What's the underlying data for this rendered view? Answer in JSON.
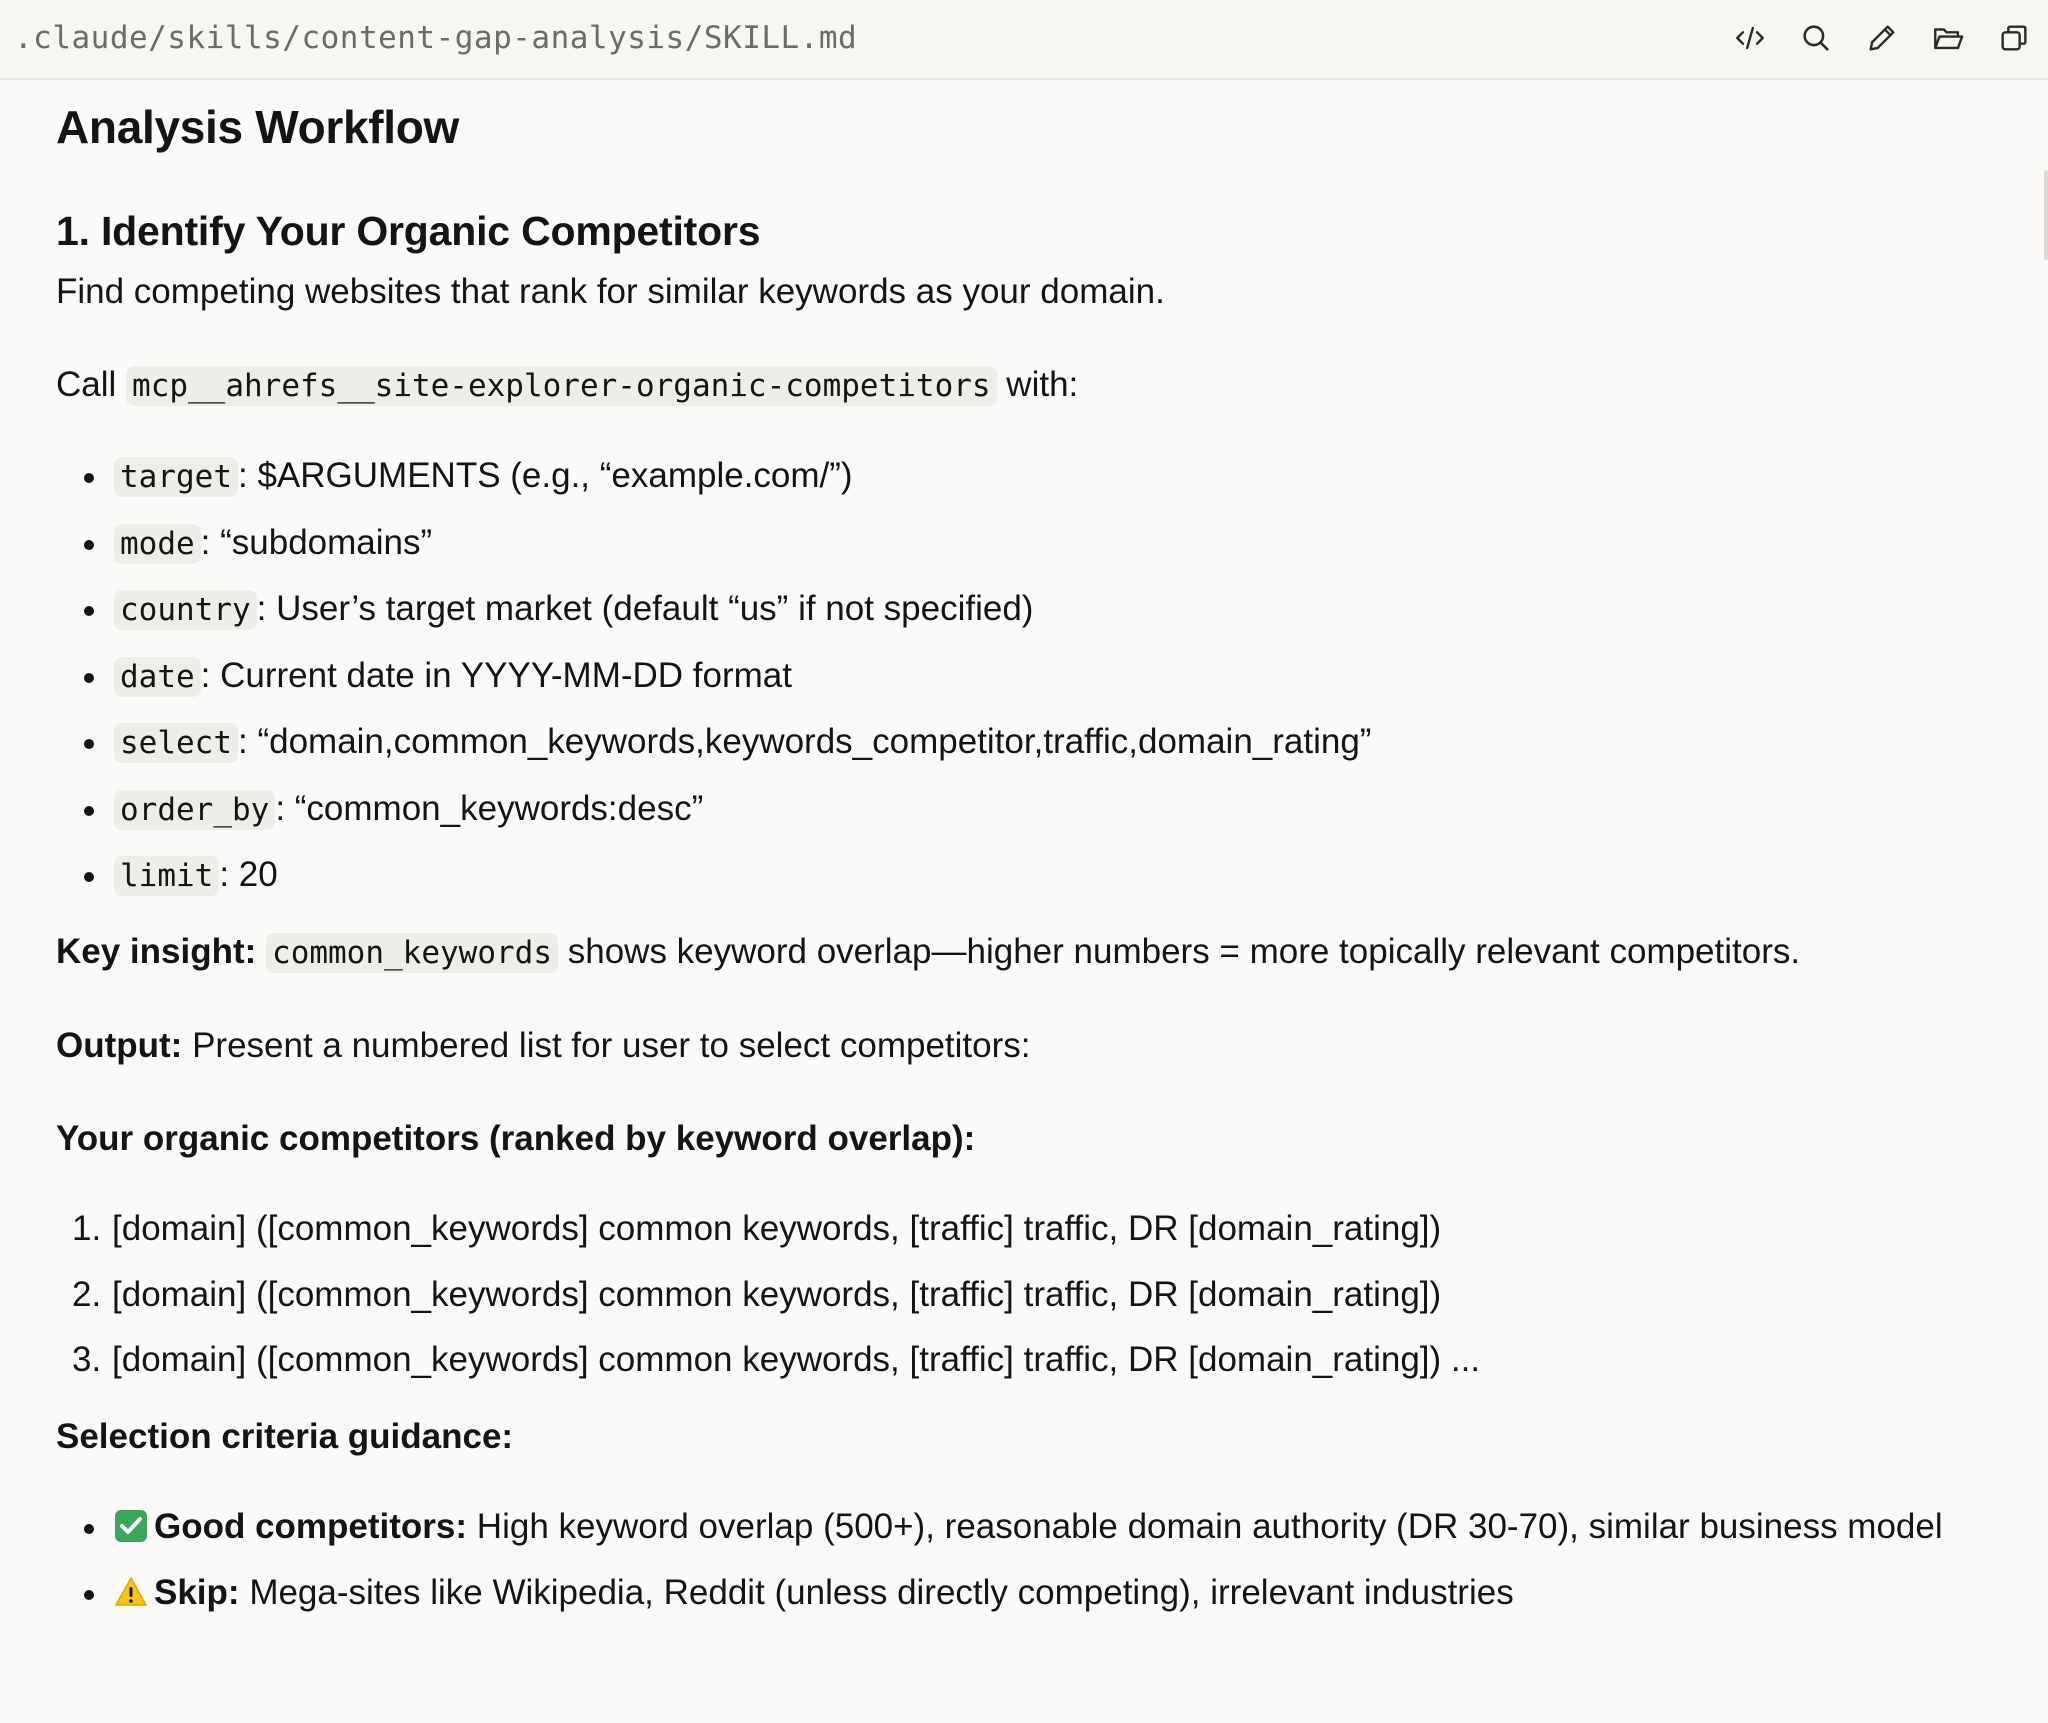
{
  "topbar": {
    "file_path": ".claude/skills/content-gap-analysis/SKILL.md",
    "tools": [
      {
        "name": "code-view-icon"
      },
      {
        "name": "search-icon"
      },
      {
        "name": "edit-pencil-icon"
      },
      {
        "name": "open-folder-icon"
      },
      {
        "name": "copy-icon"
      }
    ]
  },
  "doc": {
    "title": "Analysis Workflow",
    "step1": {
      "heading": "1. Identify Your Organic Competitors",
      "description": "Find competing websites that rank for similar keywords as your domain.",
      "call_prefix": "Call",
      "call_fn": "mcp__ahrefs__site-explorer-organic-competitors",
      "call_suffix": "with:",
      "params": [
        {
          "key": "target",
          "sep": ":",
          "value": "$ARGUMENTS (e.g., “example.com/”)"
        },
        {
          "key": "mode",
          "sep": ":",
          "value": "“subdomains”"
        },
        {
          "key": "country",
          "sep": ":",
          "value": "User’s target market (default “us” if not specified)"
        },
        {
          "key": "date",
          "sep": ":",
          "value": "Current date in YYYY-MM-DD format"
        },
        {
          "key": "select",
          "sep": ":",
          "value": "“domain,common_keywords,keywords_competitor,traffic,domain_rating”"
        },
        {
          "key": "order_by",
          "sep": ":",
          "value": "“common_keywords:desc”"
        },
        {
          "key": "limit",
          "sep": ":",
          "value": "20"
        }
      ],
      "insight_label": "Key insight:",
      "insight_code": "common_keywords",
      "insight_text": "shows keyword overlap—higher numbers = more topically relevant competitors.",
      "output_label": "Output:",
      "output_text": "Present a numbered list for user to select competitors:",
      "ranked_heading": "Your organic competitors (ranked by keyword overlap):",
      "competitors": [
        {
          "num": "1.",
          "text": "[domain] ([common_keywords] common keywords, [traffic] traffic, DR [domain_rating])"
        },
        {
          "num": "2.",
          "text": "[domain] ([common_keywords] common keywords, [traffic] traffic, DR [domain_rating])"
        },
        {
          "num": "3.",
          "text": "[domain] ([common_keywords] common keywords, [traffic] traffic, DR [domain_rating]) ..."
        }
      ],
      "criteria_heading": "Selection criteria guidance:",
      "criteria": [
        {
          "icon": "check-mark-icon",
          "label": "Good competitors:",
          "text": "High keyword overlap (500+), reasonable domain authority (DR 30-70), similar business model"
        },
        {
          "icon": "warning-icon",
          "label": "Skip:",
          "text": "Mega-sites like Wikipedia, Reddit (unless directly competing), irrelevant industries"
        }
      ]
    }
  },
  "colors": {
    "background": "#fbfaf8",
    "text": "#141413",
    "code_bg": "#efede8",
    "check_green": "#3ca55c",
    "warning_yellow": "#f5c518"
  }
}
